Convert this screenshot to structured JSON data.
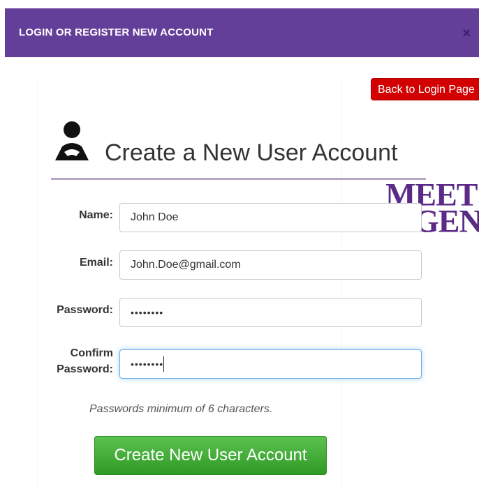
{
  "header": {
    "title": "LOGIN OR REGISTER NEW ACCOUNT",
    "close_icon": "×"
  },
  "back_button": {
    "label": "Back to Login Page"
  },
  "page_title": "Create a New User Account",
  "watermark": {
    "line1": "MEET",
    "line2": "GEN"
  },
  "form": {
    "name_label": "Name:",
    "name_value": "John Doe",
    "email_label": "Email:",
    "email_value": "John.Doe@gmail.com",
    "password_label": "Password:",
    "password_value": "••••••••",
    "confirm_label_1": "Confirm",
    "confirm_label_2": "Password:",
    "confirm_value": "••••••••",
    "hint": "Passwords minimum of 6 characters.",
    "submit_label": "Create New User Account"
  },
  "colors": {
    "header_bg": "#643f9a",
    "back_button_bg": "#d20000",
    "submit_bg": "#3fae35",
    "watermark": "#5a2a86"
  }
}
